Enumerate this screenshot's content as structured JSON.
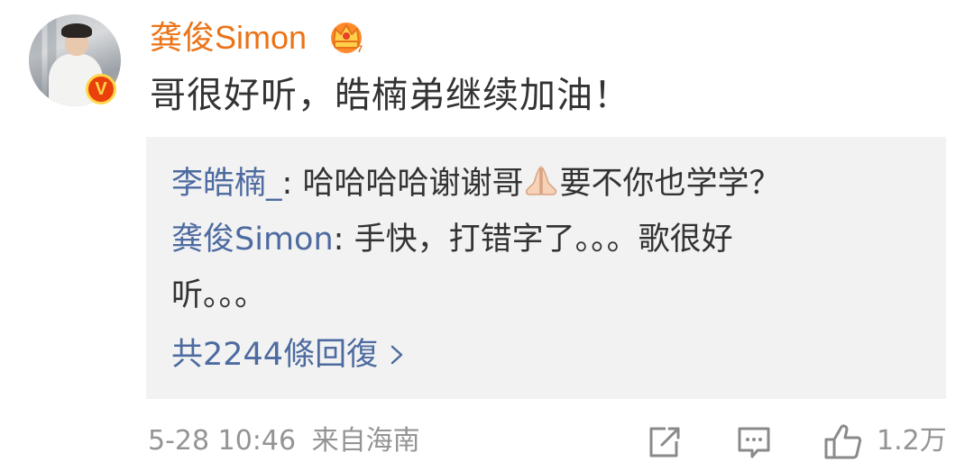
{
  "comment": {
    "username": "龚俊Simon",
    "level_badge": "crown-icon",
    "verified_badge": "V",
    "text": "哥很好听，皓楠弟继续加油！",
    "accent_color": "#eb7317"
  },
  "replies": [
    {
      "name": "李皓楠_",
      "sep": ": ",
      "text_before": "哈哈哈哈谢谢哥",
      "emoji": "folded-hands-icon",
      "text_after": "要不你也学学？"
    },
    {
      "name": "龚俊Simon",
      "sep": ": ",
      "text": "手快，打错字了。。。歌很好",
      "text_cont": "听。。。"
    }
  ],
  "more_replies": "共2244條回復",
  "footer": {
    "time": "5-28 10:46",
    "source": "来自海南",
    "like_count": "1.2万"
  },
  "colors": {
    "link_blue": "#4d6ba0",
    "text_dark": "#333333",
    "meta_gray": "#949494",
    "reply_bg": "#f2f2f2"
  }
}
